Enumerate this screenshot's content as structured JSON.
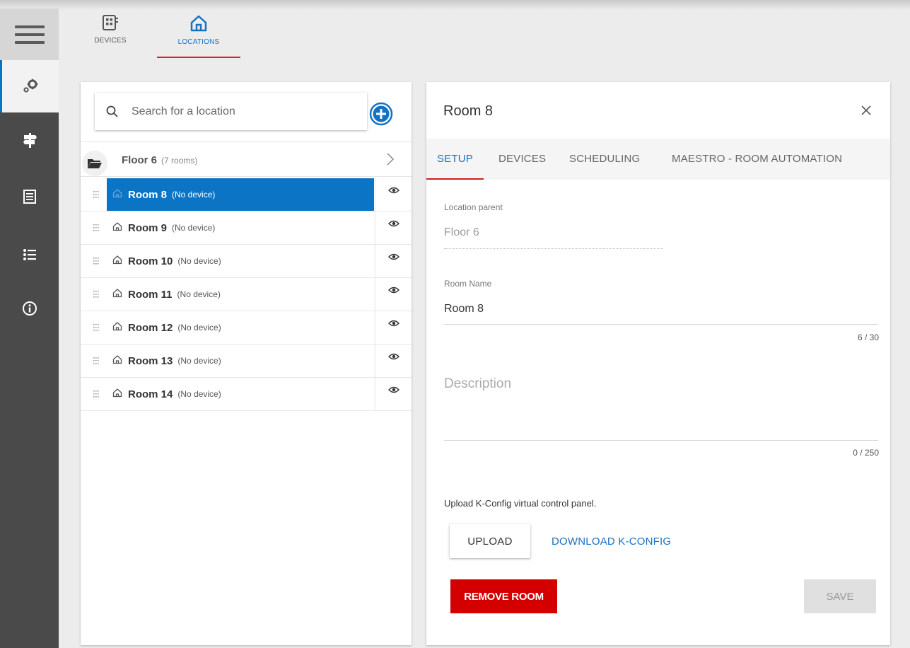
{
  "top_tabs": {
    "devices": "DEVICES",
    "locations": "LOCATIONS"
  },
  "rail": {
    "items": [
      {
        "icon": "gears-icon",
        "active": true
      },
      {
        "icon": "signpost-icon",
        "active": false
      },
      {
        "icon": "document-icon",
        "active": false
      },
      {
        "icon": "list-icon",
        "active": false
      },
      {
        "icon": "info-icon",
        "active": false
      }
    ]
  },
  "search": {
    "placeholder": "Search for a location"
  },
  "floor": {
    "name": "Floor 6",
    "count": "(7 rooms)"
  },
  "rooms": [
    {
      "name": "Room 8",
      "device": "(No device)",
      "selected": true
    },
    {
      "name": "Room 9",
      "device": "(No device)",
      "selected": false
    },
    {
      "name": "Room 10",
      "device": "(No device)",
      "selected": false
    },
    {
      "name": "Room 11",
      "device": "(No device)",
      "selected": false
    },
    {
      "name": "Room 12",
      "device": "(No device)",
      "selected": false
    },
    {
      "name": "Room 13",
      "device": "(No device)",
      "selected": false
    },
    {
      "name": "Room 14",
      "device": "(No device)",
      "selected": false
    }
  ],
  "detail": {
    "title": "Room 8",
    "tabs": [
      "SETUP",
      "DEVICES",
      "SCHEDULING",
      "MAESTRO - ROOM AUTOMATION"
    ],
    "location_parent_label": "Location parent",
    "location_parent_value": "Floor 6",
    "room_name_label": "Room Name",
    "room_name_value": "Room 8",
    "room_name_counter": "6 / 30",
    "description_placeholder": "Description",
    "description_counter": "0 / 250",
    "upload_note": "Upload K-Config virtual control panel.",
    "upload_label": "UPLOAD",
    "download_label": "DOWNLOAD K-CONFIG",
    "remove_label": "REMOVE ROOM",
    "save_label": "SAVE"
  },
  "colors": {
    "accent": "#0b74c5",
    "danger": "#d40000",
    "tab_underline": "#e02020",
    "rail": "#4a4a4a"
  }
}
